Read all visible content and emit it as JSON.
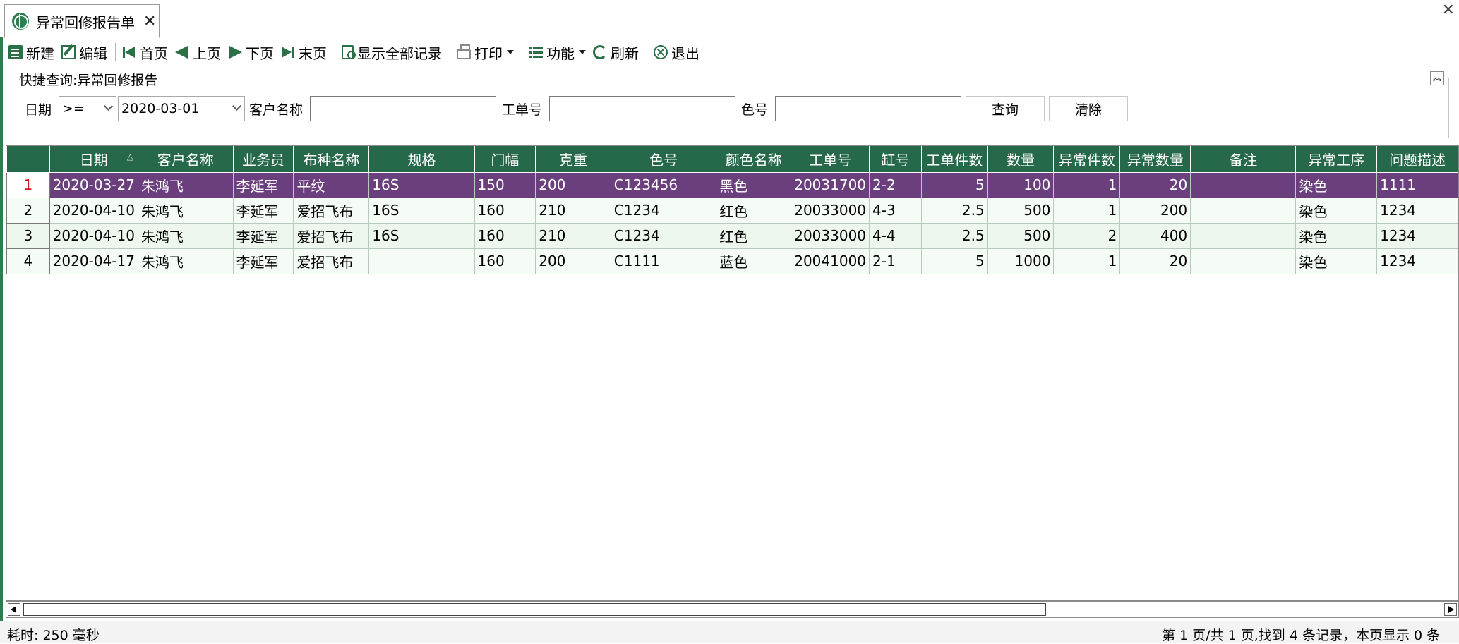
{
  "tab": {
    "title": "异常回修报告单",
    "close": "✕"
  },
  "window_close": "✕",
  "toolbar": {
    "new": "新建",
    "edit": "编辑",
    "first": "首页",
    "prev": "上页",
    "next": "下页",
    "last": "末页",
    "show_all": "显示全部记录",
    "print": "打印",
    "function": "功能",
    "refresh": "刷新",
    "exit": "退出"
  },
  "query": {
    "title": "快捷查询:异常回修报告",
    "date_label": "日期",
    "operator": ">=",
    "date_value": "2020-03-01",
    "customer_label": "客户名称",
    "customer_value": "",
    "order_label": "工单号",
    "order_value": "",
    "color_label": "色号",
    "color_value": "",
    "search_btn": "查询",
    "clear_btn": "清除"
  },
  "grid": {
    "columns": [
      "",
      "日期",
      "客户名称",
      "业务员",
      "布种名称",
      "规格",
      "门幅",
      "克重",
      "色号",
      "颜色名称",
      "工单号",
      "缸号",
      "工单件数",
      "数量",
      "异常件数",
      "异常数量",
      "备注",
      "异常工序",
      "问题描述"
    ],
    "rows": [
      [
        "1",
        "2020-03-27",
        "朱鸿飞",
        "李延军",
        "平纹",
        "16S",
        "150",
        "200",
        "C123456",
        "黑色",
        "20031700",
        "2-2",
        "5",
        "100",
        "1",
        "20",
        "",
        "染色",
        "1111"
      ],
      [
        "2",
        "2020-04-10",
        "朱鸿飞",
        "李延军",
        "爱招飞布",
        "16S",
        "160",
        "210",
        "C1234",
        "红色",
        "20033000",
        "4-3",
        "2.5",
        "500",
        "1",
        "200",
        "",
        "染色",
        "1234"
      ],
      [
        "3",
        "2020-04-10",
        "朱鸿飞",
        "李延军",
        "爱招飞布",
        "16S",
        "160",
        "210",
        "C1234",
        "红色",
        "20033000",
        "4-4",
        "2.5",
        "500",
        "2",
        "400",
        "",
        "染色",
        "1234"
      ],
      [
        "4",
        "2020-04-17",
        "朱鸿飞",
        "李延军",
        "爱招飞布",
        "",
        "160",
        "200",
        "C1111",
        "蓝色",
        "20041000",
        "2-1",
        "5",
        "1000",
        "1",
        "20",
        "",
        "染色",
        "1234"
      ]
    ],
    "selected_row": 0,
    "sorted_column": "日期"
  },
  "status": {
    "elapsed": "耗时: 250 毫秒",
    "paging": "第 1 页/共 1 页,找到 4 条记录，本页显示 0 条"
  },
  "colors": {
    "header_bg": "#25694a",
    "selected_row_bg": "#6b3f7e",
    "row_bg": "#eef7ee"
  }
}
